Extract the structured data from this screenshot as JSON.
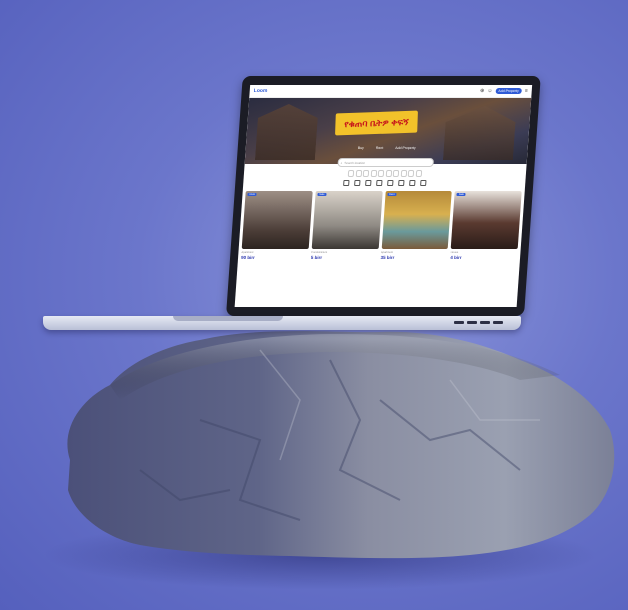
{
  "scene": {
    "background_color": "#6b76cb",
    "objects": [
      "laptop-icon",
      "rock-icon"
    ]
  },
  "website": {
    "logo": "Loom",
    "header_button": "Add Property",
    "hero_title": "የቁጠባ ቤትዎ ቀፍኝ",
    "hero_links": [
      "Buy",
      "Rent",
      "Add Property"
    ],
    "search_placeholder": "Search location",
    "brand_color": "#2f5bd6",
    "hero_title_color": "#c7181b",
    "hero_title_bg": "#f2c22a"
  },
  "listings": [
    {
      "badge": "Rent",
      "type": "Apartment",
      "price": "90 birr"
    },
    {
      "badge": "Sale",
      "type": "Condominium",
      "price": "5 birr"
    },
    {
      "badge": "Rent",
      "type": "Apartment",
      "price": "35 birr"
    },
    {
      "badge": "Sale",
      "type": "House",
      "price": "4 birr"
    }
  ]
}
